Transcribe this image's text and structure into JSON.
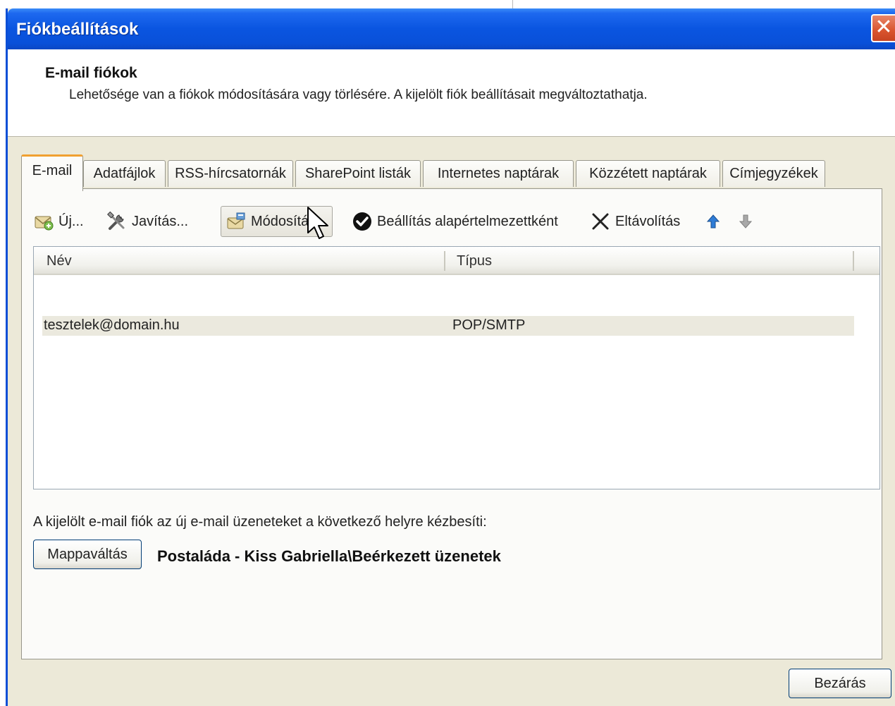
{
  "window": {
    "title": "Fiókbeállítások",
    "close_glyph": "✕"
  },
  "header": {
    "title": "E-mail fiókok",
    "description": "Lehetősége van a fiókok módosítására vagy törlésére. A kijelölt fiók beállításait megváltoztathatja."
  },
  "tabs": [
    {
      "label": "E-mail",
      "active": true
    },
    {
      "label": "Adatfájlok"
    },
    {
      "label": "RSS-hírcsatornák"
    },
    {
      "label": "SharePoint listák"
    },
    {
      "label": "Internetes naptárak"
    },
    {
      "label": "Közzétett naptárak"
    },
    {
      "label": "Címjegyzékek"
    }
  ],
  "toolbar": {
    "new": {
      "label": "Új...",
      "icon": "new-account-icon"
    },
    "repair": {
      "label": "Javítás...",
      "icon": "repair-tools-icon"
    },
    "change": {
      "label": "Módosítás...",
      "icon": "change-account-icon"
    },
    "set_default": {
      "label": "Beállítás alapértelmezettként",
      "icon": "checkmark-circle-icon"
    },
    "remove": {
      "label": "Eltávolítás",
      "icon": "x-icon"
    },
    "move_up": {
      "icon": "arrow-up-icon",
      "color": "#2e7cd6"
    },
    "move_down": {
      "icon": "arrow-down-icon",
      "color": "#a0a0a0"
    }
  },
  "account_list": {
    "columns": {
      "name": "Név",
      "type": "Típus"
    },
    "rows": [
      {
        "name": "tesztelek@domain.hu",
        "type": "POP/SMTP",
        "selected": true
      }
    ]
  },
  "delivery": {
    "text": "A kijelölt e-mail fiók az új e-mail üzeneteket a következő helyre kézbesíti:",
    "change_folder_label": "Mappaváltás",
    "folder_path": "Postaláda - Kiss Gabriella\\Beérkezett üzenetek"
  },
  "footer": {
    "close_label": "Bezárás"
  },
  "colors": {
    "titlebar": "#0a55e0",
    "dialog_bg": "#ece9d8",
    "active_tab_accent": "#f0a030",
    "selected_row": "#ebe9de"
  }
}
